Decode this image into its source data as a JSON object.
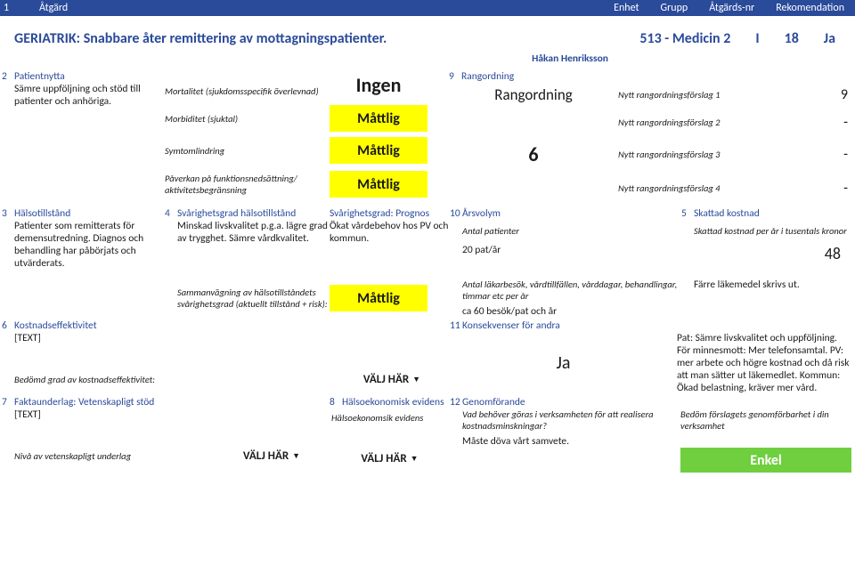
{
  "bluebar": {
    "num": "1",
    "atgard": "Åtgärd",
    "enhet": "Enhet",
    "grupp": "Grupp",
    "atgardsnr": "Åtgärds-nr",
    "rek": "Rekomendation"
  },
  "header": {
    "title": "GERIATRIK: Snabbare åter remittering av mottagningspatienter.",
    "unit": "513 - Medicin 2",
    "grupp": "I",
    "atgardsnr": "18",
    "rek": "Ja",
    "person": "Håkan Henriksson"
  },
  "s2": {
    "num": "2",
    "title": "Patientnytta",
    "body": "Sämre uppföljning och stöd till patienter och anhöriga."
  },
  "sev": {
    "r1": {
      "label": "Mortalitet (sjukdomsspecifik överlevnad)",
      "val": "Ingen"
    },
    "r2": {
      "label": "Morbiditet (sjuktal)",
      "val": "Måttlig"
    },
    "r3": {
      "label": "Symtomlindring",
      "val": "Måttlig"
    },
    "r4": {
      "label": "Påverkan på funktionsnedsättning/ aktivitetsbegränsning",
      "val": "Måttlig"
    }
  },
  "s9": {
    "num": "9",
    "title": "Rangordning",
    "big": "Rangordning",
    "r1": {
      "label": "Nytt rangordningsförslag 1",
      "val": "9"
    },
    "r2": {
      "label": "Nytt rangordningsförslag 2",
      "val": "-"
    },
    "r3": {
      "label": "Nytt rangordningsförslag 3",
      "val": "-"
    },
    "r4": {
      "label": "Nytt rangordningsförslag 4",
      "val": "-"
    },
    "six": "6"
  },
  "s3": {
    "num": "3",
    "title": "Hälsotillstånd",
    "body": "Patienter som remitterats för demensutredning. Diagnos och behandling har påbörjats och utvärderats."
  },
  "s4": {
    "num": "4",
    "title": "Svårighetsgrad hälsotillstånd",
    "body": "Minskad livskvalitet p.g.a. lägre grad av trygghet. Sämre vårdkvalitet.",
    "sum_label": "Sammanvägning av hälsotillståndets svårighetsgrad (aktuellt tillstånd + risk):",
    "sum_val": "Måttlig"
  },
  "prognos": {
    "title": "Svårighetsgrad: Prognos",
    "body": "Ökat vårdebehov hos PV och kommun."
  },
  "s10": {
    "num": "10",
    "title": "Årsvolym",
    "ap_label": "Antal patienter",
    "ap_val": "20 pat/år",
    "sub": "Antal läkarbesök, vårdtillfällen, vårddagar, behandlingar, timmar etc per år",
    "sub_val": "ca 60 besök/pat och år"
  },
  "s5": {
    "num": "5",
    "title": "Skattad kostnad",
    "label": "Skattad kostnad per år i tusentals kronor",
    "val": "48",
    "extra": "Färre läkemedel skrivs ut."
  },
  "s6": {
    "num": "6",
    "title": "Kostnadseffektivitet",
    "body": "[TEXT]",
    "label": "Bedömd grad av kostnadseffektivitet:",
    "sel": "VÄLJ HÄR"
  },
  "s11": {
    "num": "11",
    "title": "Konsekvenser för andra",
    "val": "Ja",
    "body": "Pat: Sämre livskvalitet och uppföljning. För minnesmott: Mer telefonsamtal. PV: mer arbete och högre kostnad och då risk att man sätter ut läkemedlet. Kommun: Ökad belastning, kräver mer vård."
  },
  "s7": {
    "num": "7",
    "title": "Faktaunderlag: Vetenskapligt stöd",
    "body": "[TEXT]",
    "label": "Nivå av vetenskapligt underlag",
    "sel": "VÄLJ HÄR"
  },
  "s8": {
    "num": "8",
    "title": "Hälsoekonomisk evidens",
    "label": "Hälsoekonomsik evidens",
    "sel": "VÄLJ HÄR"
  },
  "s12": {
    "num": "12",
    "title": "Genomförande",
    "q": "Vad behöver göras i verksamheten för att realisera kostnadsminskningar?",
    "a": "Måste döva vårt samvete.",
    "r_label": "Bedöm förslagets genomförbarhet i din verksamhet",
    "r_val": "Enkel"
  }
}
